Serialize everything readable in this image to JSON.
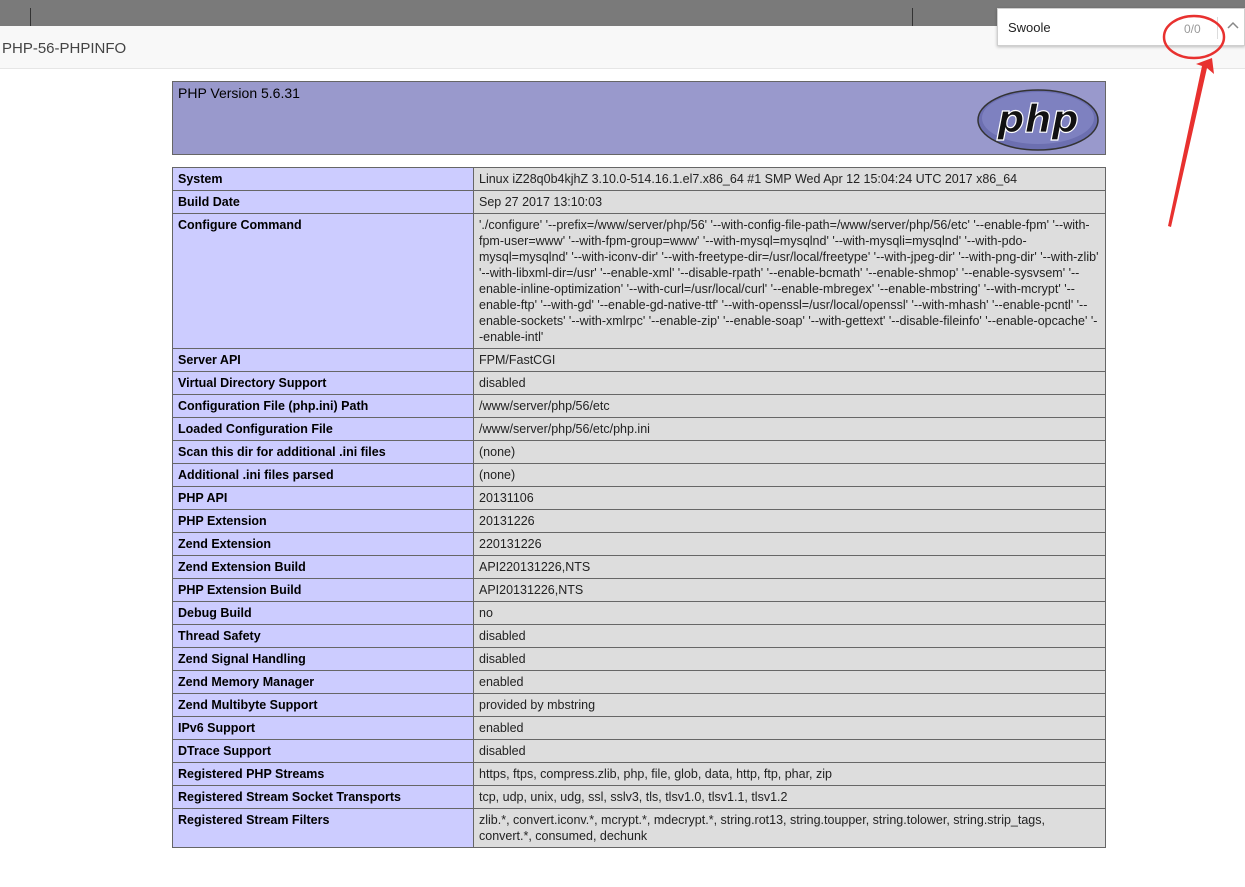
{
  "browser": {
    "tab_title": "PHP-56-PHPINFO",
    "find": {
      "query": "Swoole",
      "count": "0/0",
      "up_icon": "chevron-up-icon"
    }
  },
  "phpinfo": {
    "version": "PHP Version 5.6.31",
    "logo_text": "php",
    "rows": [
      {
        "key": "System",
        "value": "Linux iZ28q0b4kjhZ 3.10.0-514.16.1.el7.x86_64 #1 SMP Wed Apr 12 15:04:24 UTC 2017 x86_64"
      },
      {
        "key": "Build Date",
        "value": "Sep 27 2017 13:10:03"
      },
      {
        "key": "Configure Command",
        "value": "'./configure' '--prefix=/www/server/php/56' '--with-config-file-path=/www/server/php/56/etc' '--enable-fpm' '--with-fpm-user=www' '--with-fpm-group=www' '--with-mysql=mysqlnd' '--with-mysqli=mysqlnd' '--with-pdo-mysql=mysqlnd' '--with-iconv-dir' '--with-freetype-dir=/usr/local/freetype' '--with-jpeg-dir' '--with-png-dir' '--with-zlib' '--with-libxml-dir=/usr' '--enable-xml' '--disable-rpath' '--enable-bcmath' '--enable-shmop' '--enable-sysvsem' '--enable-inline-optimization' '--with-curl=/usr/local/curl' '--enable-mbregex' '--enable-mbstring' '--with-mcrypt' '--enable-ftp' '--with-gd' '--enable-gd-native-ttf' '--with-openssl=/usr/local/openssl' '--with-mhash' '--enable-pcntl' '--enable-sockets' '--with-xmlrpc' '--enable-zip' '--enable-soap' '--with-gettext' '--disable-fileinfo' '--enable-opcache' '--enable-intl'"
      },
      {
        "key": "Server API",
        "value": "FPM/FastCGI"
      },
      {
        "key": "Virtual Directory Support",
        "value": "disabled"
      },
      {
        "key": "Configuration File (php.ini) Path",
        "value": "/www/server/php/56/etc"
      },
      {
        "key": "Loaded Configuration File",
        "value": "/www/server/php/56/etc/php.ini"
      },
      {
        "key": "Scan this dir for additional .ini files",
        "value": "(none)"
      },
      {
        "key": "Additional .ini files parsed",
        "value": "(none)"
      },
      {
        "key": "PHP API",
        "value": "20131106"
      },
      {
        "key": "PHP Extension",
        "value": "20131226"
      },
      {
        "key": "Zend Extension",
        "value": "220131226"
      },
      {
        "key": "Zend Extension Build",
        "value": "API220131226,NTS"
      },
      {
        "key": "PHP Extension Build",
        "value": "API20131226,NTS"
      },
      {
        "key": "Debug Build",
        "value": "no"
      },
      {
        "key": "Thread Safety",
        "value": "disabled"
      },
      {
        "key": "Zend Signal Handling",
        "value": "disabled"
      },
      {
        "key": "Zend Memory Manager",
        "value": "enabled"
      },
      {
        "key": "Zend Multibyte Support",
        "value": "provided by mbstring"
      },
      {
        "key": "IPv6 Support",
        "value": "enabled"
      },
      {
        "key": "DTrace Support",
        "value": "disabled"
      },
      {
        "key": "Registered PHP Streams",
        "value": "https, ftps, compress.zlib, php, file, glob, data, http, ftp, phar, zip"
      },
      {
        "key": "Registered Stream Socket Transports",
        "value": "tcp, udp, unix, udg, ssl, sslv3, tls, tlsv1.0, tlsv1.1, tlsv1.2"
      },
      {
        "key": "Registered Stream Filters",
        "value": "zlib.*, convert.iconv.*, mcrypt.*, mdecrypt.*, string.rot13, string.toupper, string.tolower, string.strip_tags, convert.*, consumed, dechunk"
      }
    ]
  },
  "colors": {
    "banner": "#9999cc",
    "key_cell": "#ccccff",
    "value_cell": "#dddddd",
    "annotation": "#e8312f"
  }
}
